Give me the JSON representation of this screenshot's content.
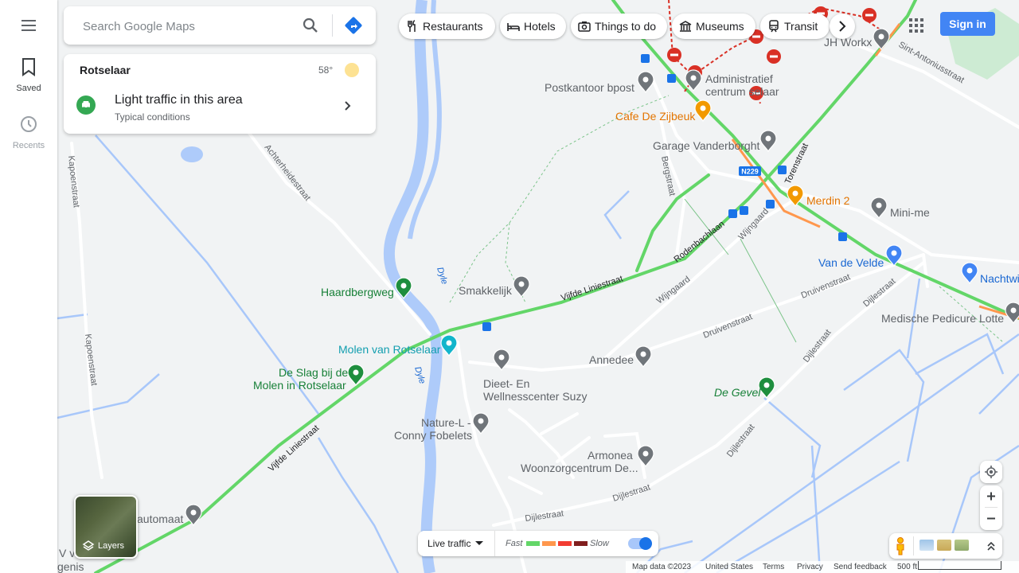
{
  "search": {
    "placeholder": "Search Google Maps"
  },
  "rail": {
    "menu_icon": "menu-icon",
    "saved_label": "Saved",
    "recents_label": "Recents"
  },
  "card": {
    "place": "Rotselaar",
    "temperature": "58°",
    "traffic_title": "Light traffic in this area",
    "traffic_subtitle": "Typical conditions"
  },
  "chips": [
    {
      "label": "Restaurants",
      "icon": "fork-knife-icon"
    },
    {
      "label": "Hotels",
      "icon": "bed-icon"
    },
    {
      "label": "Things to do",
      "icon": "camera-icon"
    },
    {
      "label": "Museums",
      "icon": "museum-icon"
    },
    {
      "label": "Transit",
      "icon": "train-icon"
    }
  ],
  "header": {
    "signin_label": "Sign in"
  },
  "layers": {
    "label": "Layers"
  },
  "live_traffic": {
    "dropdown_label": "Live traffic",
    "fast_label": "Fast",
    "slow_label": "Slow",
    "colors": [
      "#63d668",
      "#ff974d",
      "#f23c32",
      "#811f1f"
    ],
    "toggle_on": true
  },
  "footer": {
    "map_data": "Map data ©2023",
    "region": "United States",
    "terms": "Terms",
    "privacy": "Privacy",
    "feedback": "Send feedback",
    "scale": "500 ft"
  },
  "map": {
    "roads": [
      "Achterheidestraat",
      "Kapoenstraat",
      "Kapoenstraat",
      "Vijfde Liniestraat",
      "Vijfde Liniestraat",
      "Rodenbachlaan",
      "Wijngaard",
      "Wijngaard",
      "Druivenstraat",
      "Druivenstraat",
      "Dijlestraat",
      "Dijlestraat",
      "Dijlestraat",
      "Dijlestraat",
      "Dijlestraat",
      "Bergstraat",
      "Torenstraat",
      "Sint-Antoniusstraat",
      "Dyle",
      "Dyle"
    ],
    "road_badge": "N229",
    "places": [
      {
        "name": "JH Workx",
        "type": "grey"
      },
      {
        "name": "Postkantoor bpost",
        "type": "grey"
      },
      {
        "name": "Administratief centrum  selaar",
        "type": "grey"
      },
      {
        "name": "Cafe De Zijbeuk",
        "type": "orange"
      },
      {
        "name": "Garage Vanderborght",
        "type": "grey"
      },
      {
        "name": "Merdin 2",
        "type": "orange"
      },
      {
        "name": "Mini-me",
        "type": "grey"
      },
      {
        "name": "Van de Velde",
        "type": "blue"
      },
      {
        "name": "Nachtwi",
        "type": "blue"
      },
      {
        "name": "Medische Pedicure Lotte",
        "type": "grey"
      },
      {
        "name": "Haardbergweg",
        "type": "green"
      },
      {
        "name": "Smakkelijk",
        "type": "grey"
      },
      {
        "name": "Molen van Rotselaar",
        "type": "teal"
      },
      {
        "name": "De Slag bij de Molen in Rotselaar",
        "type": "green"
      },
      {
        "name": "Annedee",
        "type": "grey"
      },
      {
        "name": "Dieet- En Wellnesscenter Suzy",
        "type": "grey"
      },
      {
        "name": "Nature-L - Conny Fobelets",
        "type": "grey"
      },
      {
        "name": "Armonea Woonzorgcentrum De...",
        "type": "grey"
      },
      {
        "name": "De Gevel",
        "type": "green"
      },
      {
        "name": "automaat",
        "type": "grey"
      }
    ],
    "edge_fragments": [
      "V v",
      "genis"
    ]
  }
}
